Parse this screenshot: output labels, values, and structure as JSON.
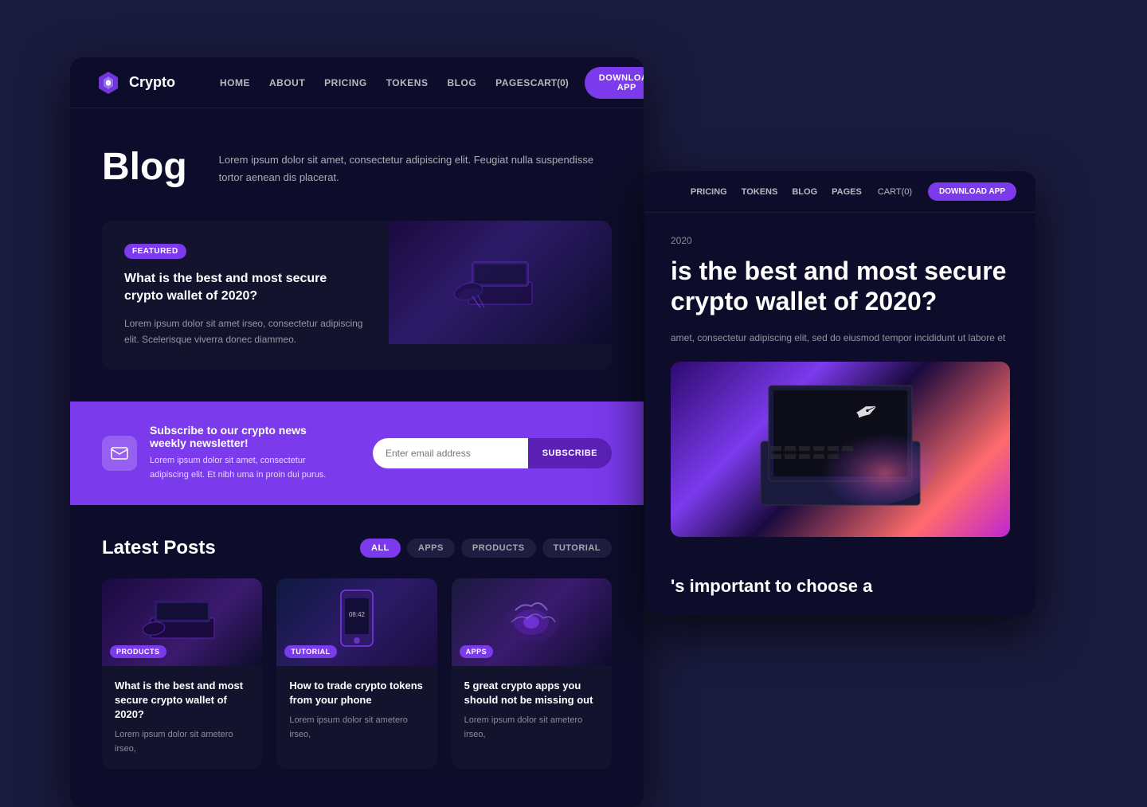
{
  "brand": {
    "name": "Crypto"
  },
  "navbar": {
    "links": [
      "HOME",
      "ABOUT",
      "PRICING",
      "TOKENS",
      "BLOG",
      "PAGES"
    ],
    "cart": "CART(0)",
    "download_btn": "DOWNLOAD APP"
  },
  "blog_hero": {
    "title": "Blog",
    "description": "Lorem ipsum dolor sit amet, consectetur adipiscing elit. Feugiat nulla suspendisse tortor aenean dis placerat."
  },
  "featured": {
    "badge": "FEATURED",
    "title": "What is the best and most secure crypto wallet of 2020?",
    "text": "Lorem ipsum dolor sit amet irseo, consectetur adipiscing elit. Scelerisque viverra donec diammeo."
  },
  "newsletter": {
    "heading": "Subscribe to our crypto news weekly newsletter!",
    "text": "Lorem ipsum dolor sit amet, consectetur adipiscing elit. Et nibh uma in proin dui purus.",
    "input_placeholder": "Enter email address",
    "button": "SUBSCRIBE"
  },
  "latest_posts": {
    "title": "Latest Posts",
    "filters": [
      "ALL",
      "APPS",
      "PRODUCTS",
      "TUTORIAL"
    ],
    "cards": [
      {
        "badge": "PRODUCTS",
        "badge_class": "badge-products",
        "title": "What is the best and most secure crypto wallet of 2020?",
        "text": "Lorem ipsum dolor sit ametero irseo,"
      },
      {
        "badge": "TUTORIAL",
        "badge_class": "badge-tutorial",
        "title": "How to trade crypto tokens from your phone",
        "text": "Lorem ipsum dolor sit ametero irseo,"
      },
      {
        "badge": "APPS",
        "badge_class": "badge-apps",
        "title": "5 great crypto apps you should not be missing out",
        "text": "Lorem ipsum dolor sit ametero irseo,"
      }
    ]
  },
  "second_window": {
    "nav_links": [
      "PRICING",
      "TOKENS",
      "BLOG",
      "PAGES"
    ],
    "cart": "CART(0)",
    "download_btn": "DOWNLOAD APP",
    "date": "2020",
    "article_title": "is the best and most secure crypto wallet of 2020?",
    "article_text": "amet, consectetur adipiscing elit, sed do eiusmod tempor incididunt ut labore et",
    "bottom_title": "'s important to choose a"
  }
}
